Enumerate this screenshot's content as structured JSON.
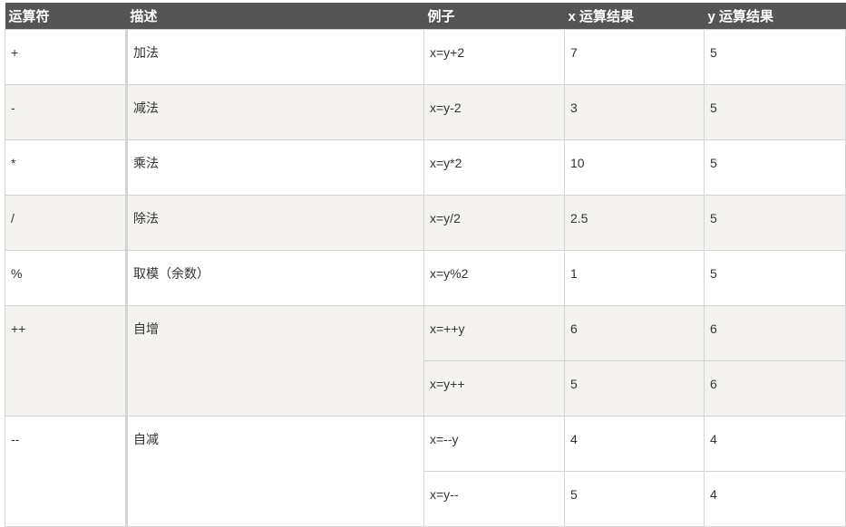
{
  "headers": [
    "运算符",
    "描述",
    "例子",
    "x 运算结果",
    "y 运算结果"
  ],
  "rows": [
    {
      "op": "+",
      "desc": "加法",
      "examples": [
        {
          "ex": "x=y+2",
          "x": "7",
          "y": "5"
        }
      ]
    },
    {
      "op": "-",
      "desc": "减法",
      "examples": [
        {
          "ex": "x=y-2",
          "x": "3",
          "y": "5"
        }
      ]
    },
    {
      "op": "*",
      "desc": "乘法",
      "examples": [
        {
          "ex": "x=y*2",
          "x": "10",
          "y": "5"
        }
      ]
    },
    {
      "op": "/",
      "desc": "除法",
      "examples": [
        {
          "ex": "x=y/2",
          "x": "2.5",
          "y": "5"
        }
      ]
    },
    {
      "op": "%",
      "desc": "取模（余数）",
      "examples": [
        {
          "ex": "x=y%2",
          "x": "1",
          "y": "5"
        }
      ]
    },
    {
      "op": "++",
      "desc": "自增",
      "examples": [
        {
          "ex": "x=++y",
          "x": "6",
          "y": "6"
        },
        {
          "ex": "x=y++",
          "x": "5",
          "y": "6"
        }
      ]
    },
    {
      "op": "--",
      "desc": "自减",
      "examples": [
        {
          "ex": "x=--y",
          "x": "4",
          "y": "4"
        },
        {
          "ex": "x=y--",
          "x": "5",
          "y": "4"
        }
      ]
    }
  ],
  "colors": {
    "header_bg": "#555555",
    "alt_row_bg": "#f4f3ef",
    "border": "#d4d4d4"
  }
}
